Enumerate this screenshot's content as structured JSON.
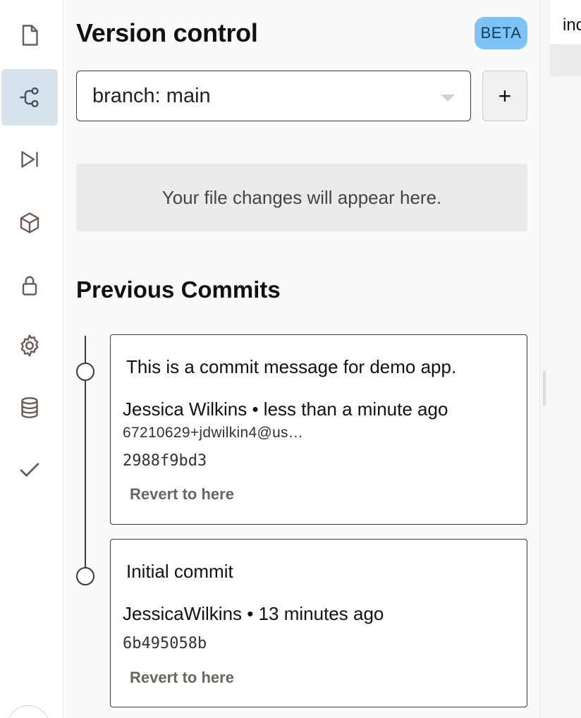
{
  "rail": {
    "items": [
      {
        "name": "file-icon",
        "active": false
      },
      {
        "name": "branch-icon",
        "active": true
      },
      {
        "name": "run-icon",
        "active": false
      },
      {
        "name": "package-icon",
        "active": false
      },
      {
        "name": "lock-icon",
        "active": false
      },
      {
        "name": "gear-icon",
        "active": false
      },
      {
        "name": "database-icon",
        "active": false
      },
      {
        "name": "check-icon",
        "active": false
      }
    ],
    "active_color": "#d7e2ec"
  },
  "panel": {
    "title": "Version control",
    "badge": "BETA",
    "badge_color": "#7cc4f7",
    "branch_select": {
      "value": "branch: main"
    },
    "add_button": "+",
    "empty_changes": "Your file changes will appear here.",
    "commits_title": "Previous Commits",
    "commits": [
      {
        "message": "This is a commit message for demo app.",
        "author_line": "Jessica Wilkins • less than a minute ago",
        "email": "67210629+jdwilkin4@us…",
        "hash": "2988f9bd3",
        "revert_label": "Revert to here"
      },
      {
        "message": "Initial commit",
        "author_line": "JessicaWilkins • 13 minutes ago",
        "email": "",
        "hash": "6b495058b",
        "revert_label": "Revert to here"
      }
    ]
  },
  "editor": {
    "tab_label": "inc"
  }
}
